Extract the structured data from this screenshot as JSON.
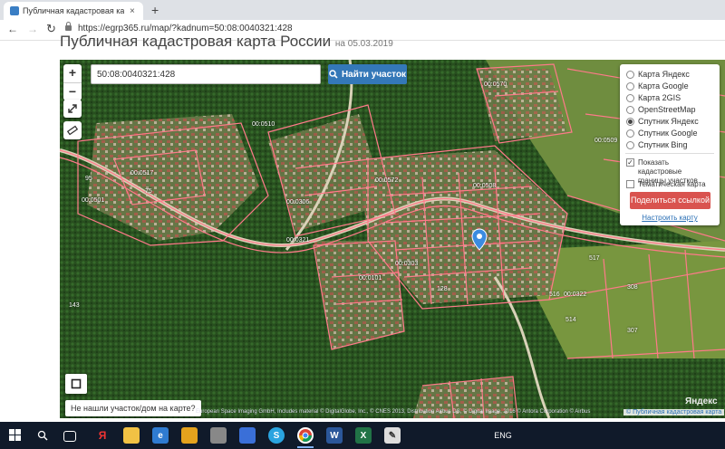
{
  "browser": {
    "tab_title": "Публичная кадастровая карта",
    "tab_close": "×",
    "new_tab": "+",
    "back": "←",
    "forward": "→",
    "reload": "↻",
    "url": "https://egrp365.ru/map/?kadnum=50:08:0040321:428"
  },
  "page": {
    "title": "Публичная кадастровая карта России",
    "date": "на 05.03.2019"
  },
  "map": {
    "search_value": "50:08:0040321:428",
    "search_button": "Найти участок",
    "zoom_in": "+",
    "zoom_out": "−",
    "layers": [
      {
        "label": "Карта Яндекс",
        "selected": false
      },
      {
        "label": "Карта Google",
        "selected": false
      },
      {
        "label": "Карта 2GIS",
        "selected": false
      },
      {
        "label": "OpenStreetMap",
        "selected": false
      },
      {
        "label": "Спутник Яндекс",
        "selected": true
      },
      {
        "label": "Спутник Google",
        "selected": false
      },
      {
        "label": "Спутник Bing",
        "selected": false
      }
    ],
    "checkboxes": [
      {
        "label": "Показать кадастровые границы участков",
        "checked": true
      },
      {
        "label": "Тематическая карта",
        "checked": false
      }
    ],
    "share_button": "Поделиться ссылкой",
    "setup_link": "Настроить карту",
    "not_found": "Не нашли участок/дом на карте?",
    "copyright": "European Space Imaging GmbH, Includes material © DigitalGlobe, Inc., © CNES 2013, Distribution Airbus DS, © Digital Image, 2016 © Antora Corporation © Airbus",
    "brand": "Яндекс",
    "pkk_link": "© Публичная кадастровая карта",
    "parcel_labels": [
      "00:0570",
      "00:0510",
      "00:0509",
      "00:0517",
      "00:0572",
      "00:0508",
      "00:0501",
      "00:0306",
      "00:0321",
      "00:0303",
      "00:0101",
      "00:0322",
      "517",
      "516",
      "514",
      "308",
      "307",
      "143",
      "128",
      "95",
      "75"
    ]
  },
  "taskbar": {
    "lang": "ENG",
    "time": "",
    "icons": [
      "search-icon",
      "task-view-icon",
      "yandex-icon",
      "explorer-icon",
      "edge-icon",
      "store-icon",
      "folder-icon",
      "mail-icon",
      "skype-icon",
      "chrome-icon",
      "word-icon",
      "excel-icon",
      "paint-icon"
    ]
  }
}
